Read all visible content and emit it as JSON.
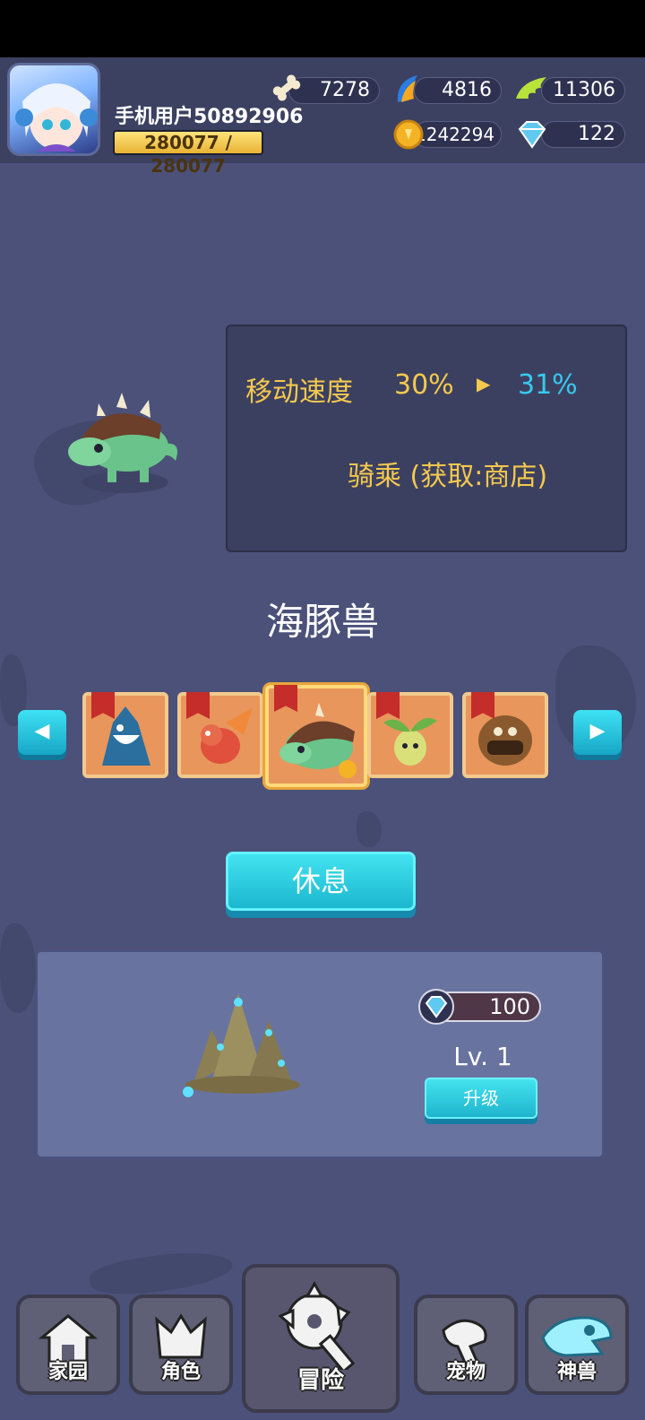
{
  "player": {
    "name": "手机用户50892906",
    "exp_text": "280077 / 280077",
    "exp_fraction": 1.0
  },
  "resources": {
    "bone": "7278",
    "horn": "4816",
    "wing": "11306",
    "gold": "1242294",
    "diamond": "122"
  },
  "pet_info": {
    "stat_label": "移动速度",
    "stat_current": "30%",
    "stat_arrow": "▶",
    "stat_next": "31%",
    "ride_text": "骑乘 (获取:商店)"
  },
  "pet_name": "海豚兽",
  "carousel": {
    "prev_icon": "left-triangle-icon",
    "next_icon": "right-triangle-icon",
    "pets": [
      "blue-shark-pet",
      "red-dragon-pet",
      "green-dino-pet",
      "leaf-sprout-pet",
      "mud-golem-pet"
    ],
    "selected_index": 2
  },
  "rest_button": "休息",
  "upgrade": {
    "cost": "100",
    "level": "Lv. 1",
    "button_label": "升级"
  },
  "nav": {
    "home": "家园",
    "role": "角色",
    "adventure": "冒险",
    "pet": "宠物",
    "beast": "神兽",
    "active": "adventure"
  },
  "colors": {
    "background": "#4b5179",
    "gold_text": "#f5c94e",
    "cyan_text": "#38c8ee",
    "button_cyan": "#2cc8dd"
  }
}
